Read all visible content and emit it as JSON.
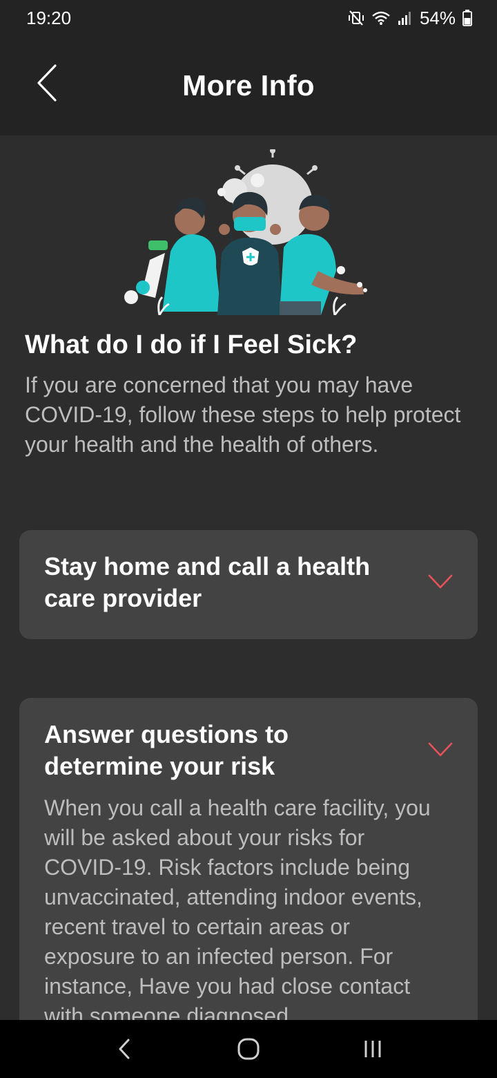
{
  "status_bar": {
    "time": "19:20",
    "battery": "54%",
    "icons": [
      "mute-vibrate-icon",
      "wifi-icon",
      "signal-icon",
      "battery-icon"
    ]
  },
  "header": {
    "title": "More Info",
    "back_icon": "chevron-left-icon"
  },
  "illustration": {
    "icon": "people-masks-virus-illustration"
  },
  "main": {
    "heading": "What do I do if I Feel Sick?",
    "intro": "If you are concerned that you may have COVID-19, follow these steps to help protect your health and the health of others."
  },
  "accordions": [
    {
      "title": "Stay home and call a health care provider",
      "expanded": false,
      "icon": "chevron-down-icon"
    },
    {
      "title": "Answer questions to determine your risk",
      "expanded": true,
      "icon": "chevron-down-icon",
      "body": "When you call a health care facility, you will be asked about your risks for COVID-19. Risk factors include being unvaccinated, attending indoor events, recent travel to certain areas or exposure to an infected person. For instance, Have you had close contact with someone diagnosed"
    }
  ],
  "nav_bar": {
    "buttons": [
      "back-icon",
      "home-icon",
      "recents-icon"
    ]
  },
  "colors": {
    "background": "#2d2d2d",
    "header": "#232323",
    "card": "#434343",
    "accent": "#e8535b",
    "secondary_text": "#bdbdbd",
    "illustration_teal": "#1fc6c8"
  }
}
